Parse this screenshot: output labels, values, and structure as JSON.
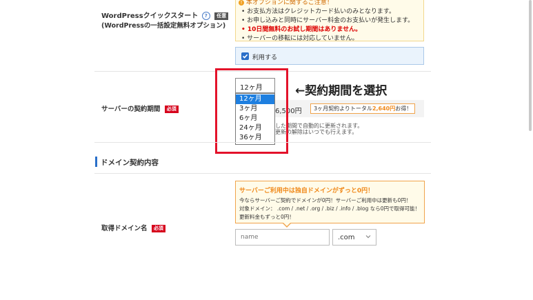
{
  "wordpress_row": {
    "title": "WordPressクイックスタート",
    "help_icon": "?",
    "badge": "任意",
    "subtitle": "(WordPressの一括設定無料オプション)"
  },
  "notice": {
    "header": "本オプションに関するご注意！",
    "items": [
      "お支払方法はクレジットカード払いのみとなります。",
      "お申し込みと同時にサーバー料金のお支払いが発生します。",
      "10日間無料のお試し期間はありません。",
      "サーバーの移転には対応していません。"
    ]
  },
  "use_checkbox": {
    "label": "利用する",
    "checked": true
  },
  "server_period": {
    "label": "サーバーの契約期間",
    "badge": "必須",
    "selected": "12ヶ月",
    "options": [
      "12ヶ月",
      "3ヶ月",
      "6ヶ月",
      "24ヶ月",
      "36ヶ月"
    ],
    "price_fragment": "6,500円",
    "promo_prefix": "3ヶ月契約よりトータル",
    "promo_amount": "2,640円",
    "promo_suffix": "お得！",
    "note1": "した期間で自動的に更新されます。",
    "note2": "更新の解除はいつでも行えます。"
  },
  "annotation": "←契約期間を選択",
  "domain_section": {
    "heading": "ドメイン契約内容",
    "promo_title": "サーバーご利用中は独自ドメインがずっと0円！",
    "promo_line1": "今ならサーバーご契約でドメインが0円！サーバーご利用中は更新も0円！",
    "promo_line2": "対象ドメイン： .com / .net / .org / .biz / .info / .blog なら0円で取得可能！",
    "promo_line3": "更新料金もずっと0円！",
    "field_label": "取得ドメイン名",
    "badge": "必須",
    "input_placeholder": "name",
    "tld_selected": ".com"
  },
  "colors": {
    "accent_blue": "#1e7fe0",
    "required_red": "#d6001c",
    "highlight_frame": "#e3122a",
    "promo_orange": "#f08a1c"
  }
}
